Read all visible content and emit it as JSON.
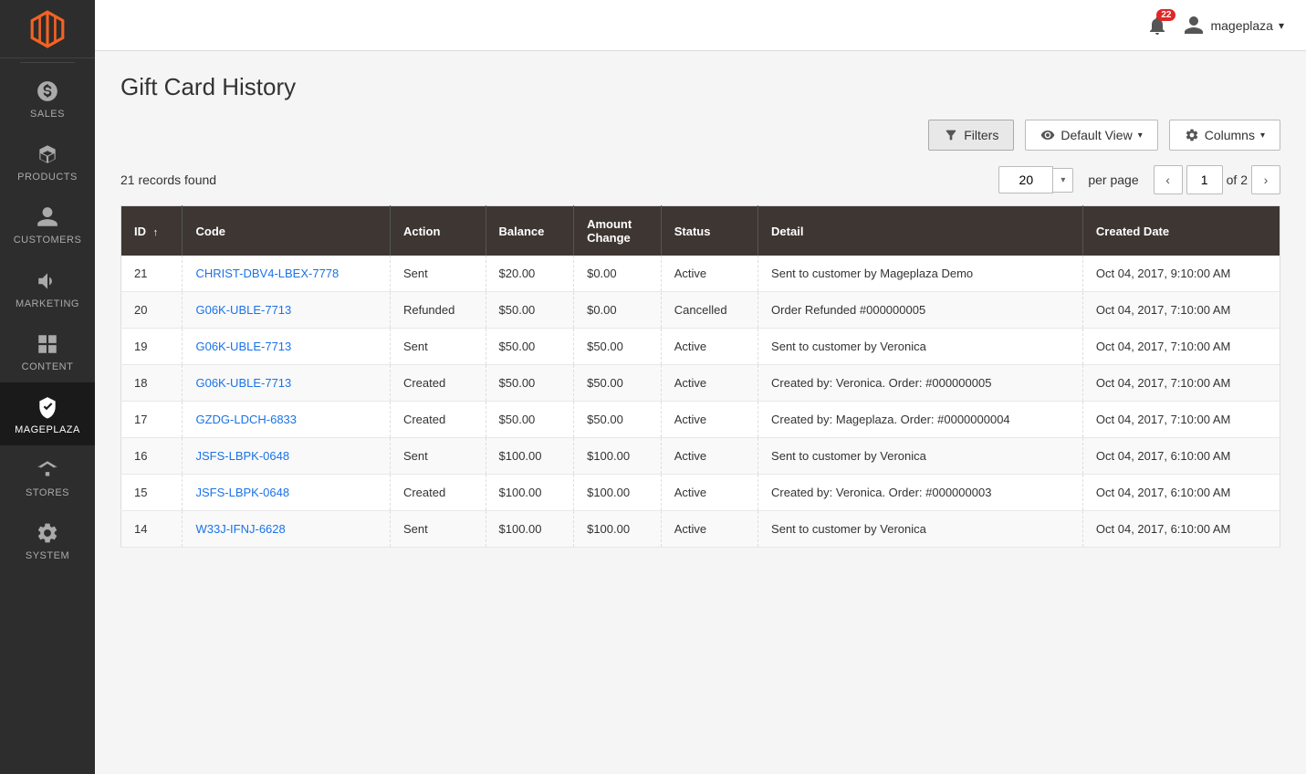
{
  "app": {
    "title": "Gift Card History"
  },
  "topbar": {
    "notifications_count": "22",
    "user_name": "mageplaza",
    "user_chevron": "▾"
  },
  "sidebar": {
    "items": [
      {
        "id": "sales",
        "label": "SALES",
        "icon": "dollar"
      },
      {
        "id": "products",
        "label": "PRODUCTS",
        "icon": "box"
      },
      {
        "id": "customers",
        "label": "CUSTOMERS",
        "icon": "person"
      },
      {
        "id": "marketing",
        "label": "MARKETING",
        "icon": "megaphone"
      },
      {
        "id": "content",
        "label": "CONTENT",
        "icon": "grid"
      },
      {
        "id": "mageplaza",
        "label": "MAGEPLAZA",
        "icon": "shield",
        "active": true
      },
      {
        "id": "stores",
        "label": "STORES",
        "icon": "storefront"
      },
      {
        "id": "system",
        "label": "SYSTEM",
        "icon": "gear"
      }
    ]
  },
  "toolbar": {
    "filters_label": "Filters",
    "view_label": "Default View",
    "columns_label": "Columns"
  },
  "records": {
    "count_text": "21 records found",
    "per_page": "20",
    "per_page_label": "per page",
    "current_page": "1",
    "total_pages": "of 2"
  },
  "table": {
    "columns": [
      {
        "key": "id",
        "label": "ID",
        "sortable": true
      },
      {
        "key": "code",
        "label": "Code"
      },
      {
        "key": "action",
        "label": "Action"
      },
      {
        "key": "balance",
        "label": "Balance"
      },
      {
        "key": "amount_change",
        "label": "Amount Change"
      },
      {
        "key": "status",
        "label": "Status"
      },
      {
        "key": "detail",
        "label": "Detail"
      },
      {
        "key": "created_date",
        "label": "Created Date"
      }
    ],
    "rows": [
      {
        "id": "21",
        "code": "CHRIST-DBV4-LBEX-7778",
        "action": "Sent",
        "action_style": "normal",
        "balance": "$20.00",
        "amount_change": "$0.00",
        "status": "Active",
        "status_style": "normal",
        "detail": "Sent to customer by Mageplaza Demo",
        "created_date": "Oct 04, 2017, 9:10:00 AM"
      },
      {
        "id": "20",
        "code": "G06K-UBLE-7713",
        "action": "Refunded",
        "action_style": "refunded",
        "balance": "$50.00",
        "amount_change": "$0.00",
        "status": "Cancelled",
        "status_style": "cancelled",
        "detail": "Order Refunded #000000005",
        "created_date": "Oct 04, 2017, 7:10:00 AM"
      },
      {
        "id": "19",
        "code": "G06K-UBLE-7713",
        "action": "Sent",
        "action_style": "normal",
        "balance": "$50.00",
        "amount_change": "$50.00",
        "status": "Active",
        "status_style": "normal",
        "detail": "Sent to customer by Veronica",
        "created_date": "Oct 04, 2017, 7:10:00 AM"
      },
      {
        "id": "18",
        "code": "G06K-UBLE-7713",
        "action": "Created",
        "action_style": "normal",
        "balance": "$50.00",
        "amount_change": "$50.00",
        "status": "Active",
        "status_style": "normal",
        "detail": "Created by: Veronica. Order: #000000005",
        "created_date": "Oct 04, 2017, 7:10:00 AM"
      },
      {
        "id": "17",
        "code": "GZDG-LDCH-6833",
        "action": "Created",
        "action_style": "normal",
        "balance": "$50.00",
        "amount_change": "$50.00",
        "status": "Active",
        "status_style": "normal",
        "detail": "Created by: Mageplaza. Order: #0000000004",
        "created_date": "Oct 04, 2017, 7:10:00 AM"
      },
      {
        "id": "16",
        "code": "JSFS-LBPK-0648",
        "action": "Sent",
        "action_style": "normal",
        "balance": "$100.00",
        "amount_change": "$100.00",
        "status": "Active",
        "status_style": "normal",
        "detail": "Sent to customer by Veronica",
        "created_date": "Oct 04, 2017, 6:10:00 AM"
      },
      {
        "id": "15",
        "code": "JSFS-LBPK-0648",
        "action": "Created",
        "action_style": "normal",
        "balance": "$100.00",
        "amount_change": "$100.00",
        "status": "Active",
        "status_style": "normal",
        "detail": "Created by: Veronica. Order: #000000003",
        "created_date": "Oct 04, 2017, 6:10:00 AM"
      },
      {
        "id": "14",
        "code": "W33J-IFNJ-6628",
        "action": "Sent",
        "action_style": "normal",
        "balance": "$100.00",
        "amount_change": "$100.00",
        "status": "Active",
        "status_style": "normal",
        "detail": "Sent to customer by Veronica",
        "created_date": "Oct 04, 2017, 6:10:00 AM"
      }
    ]
  }
}
